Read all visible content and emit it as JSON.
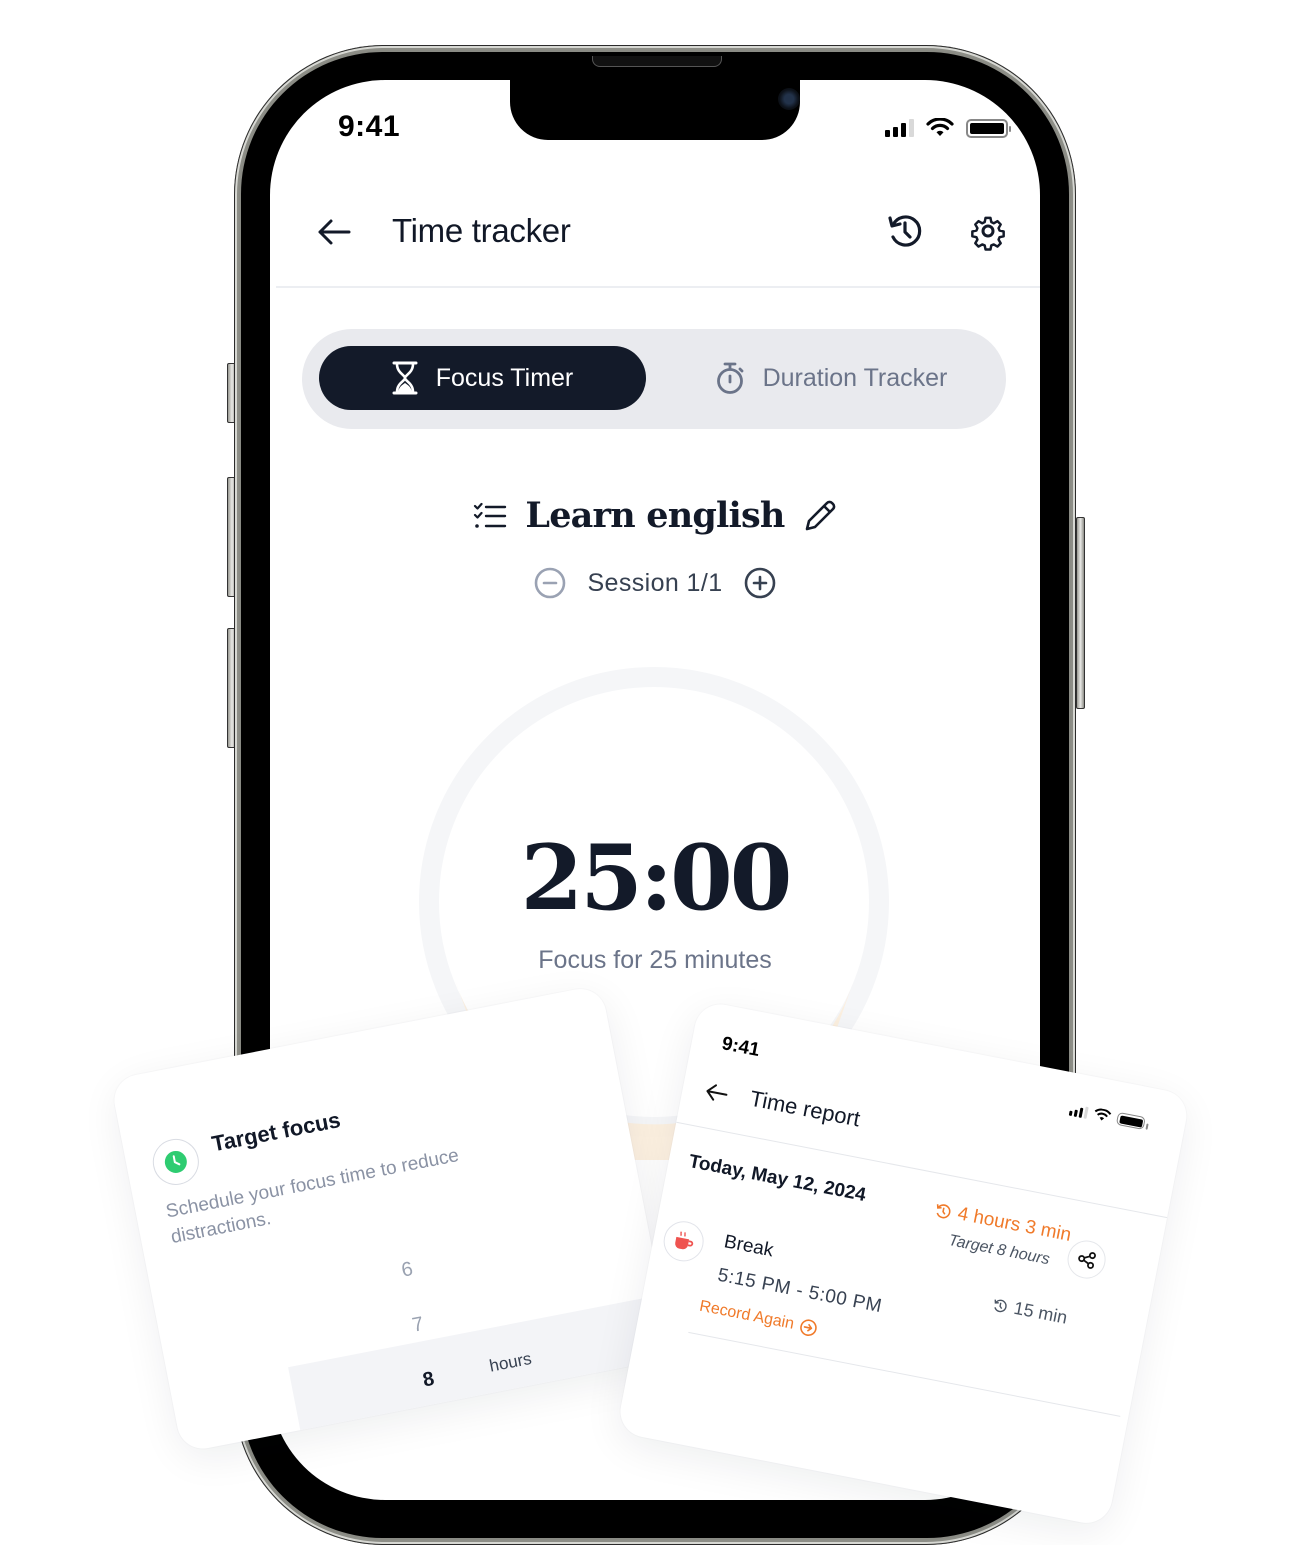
{
  "status_bar": {
    "time": "9:41",
    "signal_bars_on": 3,
    "signal_bars_total": 4
  },
  "header": {
    "title": "Time tracker",
    "back_icon": "arrow-left-icon",
    "history_icon": "history-icon",
    "settings_icon": "gear-icon"
  },
  "mode_tabs": [
    {
      "label": "Focus Timer",
      "icon": "hourglass-icon",
      "active": true
    },
    {
      "label": "Duration Tracker",
      "icon": "stopwatch-icon",
      "active": false
    }
  ],
  "task": {
    "title": "Learn english",
    "list_icon": "checklist-icon",
    "edit_icon": "pencil-icon"
  },
  "session": {
    "label": "Session 1/1",
    "decrement_icon": "minus-circle-icon",
    "increment_icon": "plus-circle-icon"
  },
  "timer": {
    "value": "25:00",
    "caption": "Focus for 25 minutes",
    "progress": 0
  },
  "colors": {
    "primary": "#131a29",
    "accent": "#f07a2a",
    "green": "#2ecc71",
    "muted": "#6b7489",
    "track": "#f5f6f8",
    "peach": "#fdefdc"
  },
  "target_focus_card": {
    "title": "Target focus",
    "description": "Schedule your focus time to reduce distractions.",
    "picker_values": [
      "6",
      "7",
      "8"
    ],
    "selected_value": "8",
    "unit": "hours"
  },
  "time_report_card": {
    "status_time": "9:41",
    "title": "Time report",
    "date": "Today, May 12, 2024",
    "total": "4 hours 3 min",
    "target": "Target 8 hours",
    "entries": [
      {
        "name": "Break",
        "range": "5:15 PM - 5:00 PM",
        "duration": "15 min",
        "action": "Record Again",
        "icon": "coffee-cup-icon"
      }
    ]
  }
}
